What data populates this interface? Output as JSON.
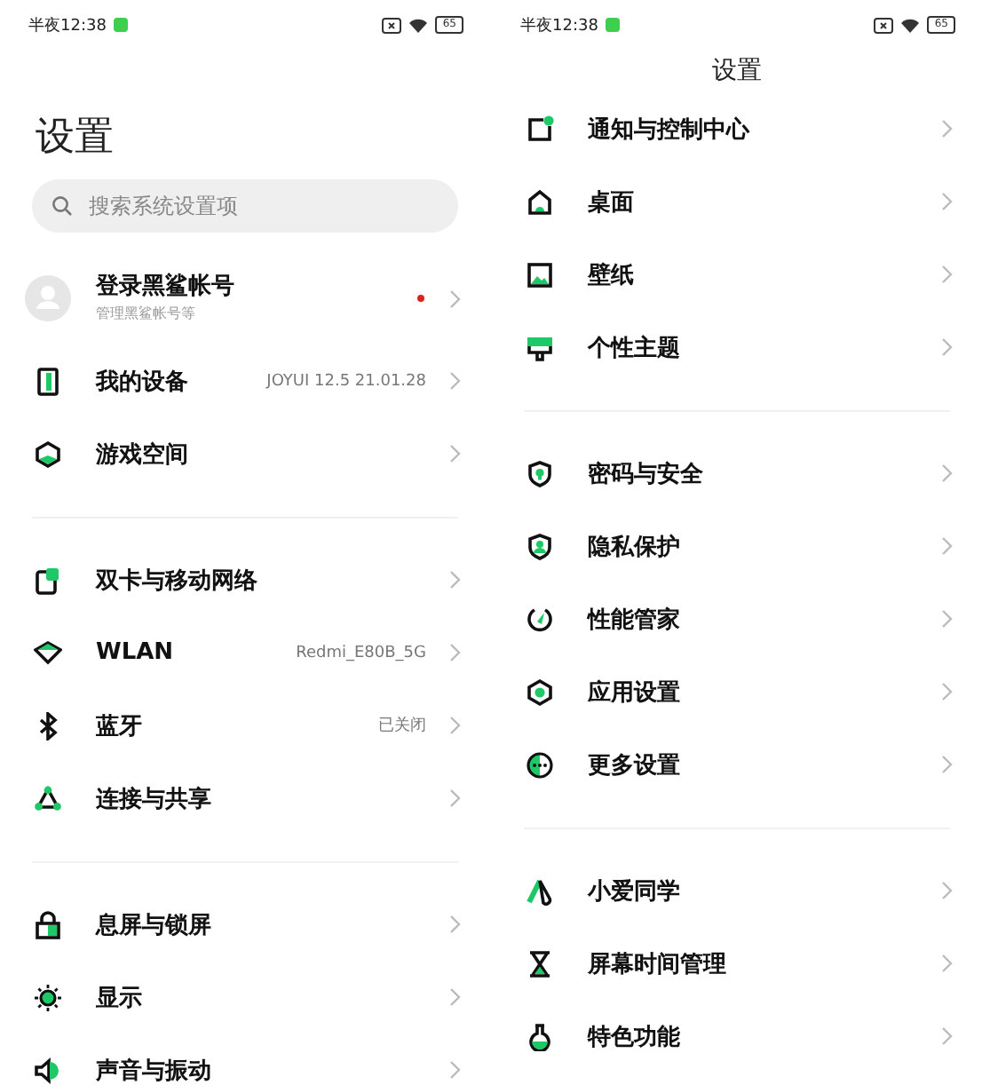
{
  "screens": [
    {
      "status_bar": {
        "time": "半夜12:38",
        "battery": "65"
      },
      "header": {
        "kind": "large",
        "title": "设置"
      },
      "search": {
        "placeholder": "搜索系统设置项"
      },
      "account": {
        "title": "登录黑鲨帐号",
        "subtitle": "管理黑鲨帐号等",
        "notification": true
      },
      "sections": [
        {
          "items": [
            {
              "label": "我的设备",
              "value": "JOYUI 12.5 21.01.28"
            },
            {
              "label": "游戏空间"
            }
          ]
        },
        {
          "items": [
            {
              "label": "双卡与移动网络"
            },
            {
              "label": "WLAN",
              "value": "Redmi_E80B_5G"
            },
            {
              "label": "蓝牙",
              "value": "已关闭"
            },
            {
              "label": "连接与共享"
            }
          ]
        },
        {
          "items": [
            {
              "label": "息屏与锁屏"
            },
            {
              "label": "显示"
            },
            {
              "label": "声音与振动"
            }
          ]
        }
      ]
    },
    {
      "status_bar": {
        "time": "半夜12:38",
        "battery": "65"
      },
      "header": {
        "kind": "centered",
        "title": "设置"
      },
      "sections": [
        {
          "items": [
            {
              "label": "通知与控制中心"
            },
            {
              "label": "桌面"
            },
            {
              "label": "壁纸"
            },
            {
              "label": "个性主题"
            }
          ]
        },
        {
          "items": [
            {
              "label": "密码与安全"
            },
            {
              "label": "隐私保护"
            },
            {
              "label": "性能管家"
            },
            {
              "label": "应用设置"
            },
            {
              "label": "更多设置"
            }
          ]
        },
        {
          "items": [
            {
              "label": "小爱同学"
            },
            {
              "label": "屏幕时间管理"
            },
            {
              "label": "特色功能"
            }
          ]
        }
      ]
    }
  ]
}
